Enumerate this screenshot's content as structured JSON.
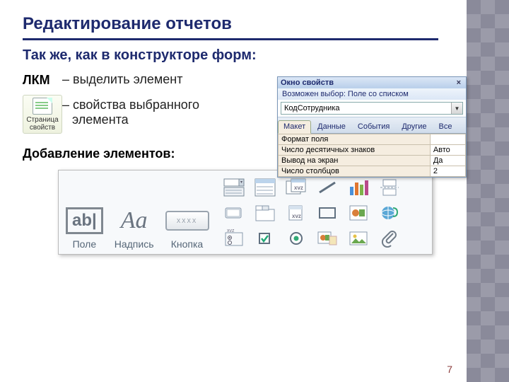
{
  "title": "Редактирование отчетов",
  "subtitle": "Так же, как в конструкторе форм:",
  "lkm_label": "ЛКМ",
  "lkm_desc": "– выделить  элемент",
  "props_btn": {
    "line1": "Страница",
    "line2": "свойств"
  },
  "props_desc1": "– свойства выбранного",
  "props_desc2": "элемента",
  "add_heading": "Добавление элементов:",
  "pane": {
    "title": "Окно свойств",
    "selection": "Возможен выбор:  Поле со списком",
    "combo_value": "КодСотрудника",
    "tabs": [
      "Макет",
      "Данные",
      "События",
      "Другие",
      "Все"
    ],
    "rows": [
      {
        "k": "Формат поля",
        "v": ""
      },
      {
        "k": "Число десятичных знаков",
        "v": "Авто"
      },
      {
        "k": "Вывод на экран",
        "v": "Да"
      },
      {
        "k": "Число столбцов",
        "v": "2"
      }
    ]
  },
  "toolbox": {
    "big": [
      {
        "name": "field-tool",
        "caption": "Поле"
      },
      {
        "name": "label-tool",
        "caption": "Надпись"
      },
      {
        "name": "button-tool",
        "caption": "Кнопка"
      }
    ]
  },
  "page_number": "7"
}
